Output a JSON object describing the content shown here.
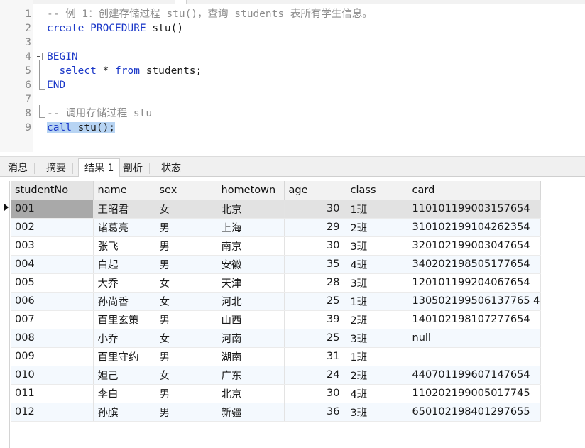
{
  "editor": {
    "lines": [
      {
        "num": "1",
        "parts": [
          {
            "t": "-- 例 1：创建存储过程 stu()，查询 students 表所有学生信息。",
            "c": "c-comment"
          }
        ]
      },
      {
        "num": "2",
        "parts": [
          {
            "t": "create ",
            "c": "c-kw"
          },
          {
            "t": "PROCEDURE ",
            "c": "c-kw"
          },
          {
            "t": "stu()",
            "c": "c-plain"
          }
        ]
      },
      {
        "num": "3",
        "parts": []
      },
      {
        "num": "4",
        "parts": [
          {
            "t": "BEGIN",
            "c": "c-kw"
          }
        ]
      },
      {
        "num": "5",
        "parts": [
          {
            "t": "  select ",
            "c": "c-kw"
          },
          {
            "t": "* ",
            "c": "c-plain"
          },
          {
            "t": "from ",
            "c": "c-kw"
          },
          {
            "t": "students;",
            "c": "c-plain"
          }
        ]
      },
      {
        "num": "6",
        "parts": [
          {
            "t": "END",
            "c": "c-kw"
          }
        ]
      },
      {
        "num": "7",
        "parts": []
      },
      {
        "num": "8",
        "parts": [
          {
            "t": "-- 调用存储过程 stu",
            "c": "c-comment"
          }
        ]
      },
      {
        "num": "9",
        "parts": [
          {
            "t": "call ",
            "c": "c-kw",
            "sel": true
          },
          {
            "t": "stu();",
            "c": "c-plain",
            "sel": true
          }
        ]
      }
    ]
  },
  "tabs": [
    {
      "label": "消息",
      "active": false
    },
    {
      "label": "摘要",
      "active": false
    },
    {
      "label": "结果 1",
      "active": true
    },
    {
      "label": "剖析",
      "active": false
    },
    {
      "label": "状态",
      "active": false
    }
  ],
  "grid": {
    "columns": [
      "studentNo",
      "name",
      "sex",
      "hometown",
      "age",
      "class",
      "card"
    ],
    "rows": [
      [
        "001",
        "王昭君",
        "女",
        "北京",
        "30",
        "1班",
        "110101199003157654"
      ],
      [
        "002",
        "诸葛亮",
        "男",
        "上海",
        "29",
        "2班",
        "310102199104262354"
      ],
      [
        "003",
        "张飞",
        "男",
        "南京",
        "30",
        "3班",
        "320102199003047654"
      ],
      [
        "004",
        "白起",
        "男",
        "安徽",
        "35",
        "4班",
        "340202198505177654"
      ],
      [
        "005",
        "大乔",
        "女",
        "天津",
        "28",
        "3班",
        "120101199204067654"
      ],
      [
        "006",
        "孙尚香",
        "女",
        "河北",
        "25",
        "1班",
        "130502199506137765 4"
      ],
      [
        "007",
        "百里玄策",
        "男",
        "山西",
        "39",
        "2班",
        "140102198107277654"
      ],
      [
        "008",
        "小乔",
        "女",
        "河南",
        "25",
        "3班",
        "null"
      ],
      [
        "009",
        "百里守约",
        "男",
        "湖南",
        "31",
        "1班",
        ""
      ],
      [
        "010",
        "妲己",
        "女",
        "广东",
        "24",
        "2班",
        "440701199607147654"
      ],
      [
        "011",
        "李白",
        "男",
        "北京",
        "30",
        "4班",
        "110202199005017745"
      ],
      [
        "012",
        "孙膑",
        "男",
        "新疆",
        "36",
        "3班",
        "650102198401297655"
      ]
    ]
  }
}
